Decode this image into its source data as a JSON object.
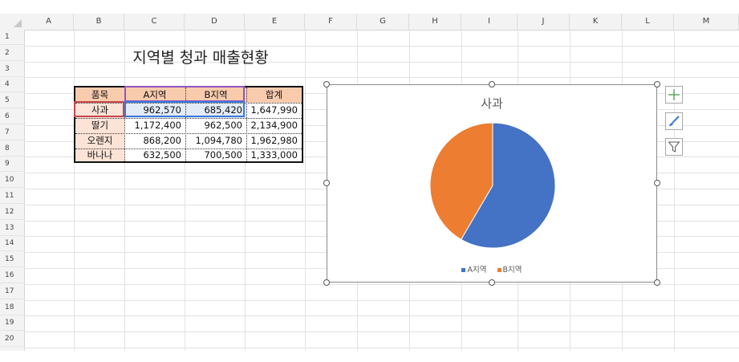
{
  "sheet": {
    "columns": [
      "A",
      "B",
      "C",
      "D",
      "E",
      "F",
      "G",
      "H",
      "I",
      "J",
      "K",
      "L",
      "M"
    ],
    "rows": [
      "1",
      "2",
      "3",
      "4",
      "5",
      "6",
      "7",
      "8",
      "9",
      "10",
      "11",
      "12",
      "13",
      "14",
      "15",
      "16",
      "17",
      "18",
      "19",
      "20"
    ]
  },
  "table": {
    "title": "지역별 청과 매출현황",
    "headers": [
      "품목",
      "A지역",
      "B지역",
      "합계"
    ],
    "rows": [
      [
        "사과",
        "962,570",
        "685,420",
        "1,647,990"
      ],
      [
        "딸기",
        "1,172,400",
        "962,500",
        "2,134,900"
      ],
      [
        "오렌지",
        "868,200",
        "1,094,780",
        "1,962,980"
      ],
      [
        "바나나",
        "632,500",
        "700,500",
        "1,333,000"
      ]
    ]
  },
  "colors": {
    "header_fill": "#f8cbad",
    "item_fill": "#fbe3d6",
    "series_a": "#4472c4",
    "series_b": "#ed7d31"
  },
  "chart": {
    "title": "사과",
    "legend_a": "A지역",
    "legend_b": "B지역"
  },
  "chart_data": {
    "type": "pie",
    "title": "사과",
    "categories": [
      "A지역",
      "B지역"
    ],
    "values": [
      962570,
      685420
    ],
    "colors": [
      "#4472c4",
      "#ed7d31"
    ],
    "legend": "bottom"
  },
  "chart_tools": {
    "add_icon": "plus-icon",
    "style_icon": "brush-icon",
    "filter_icon": "filter-icon"
  }
}
